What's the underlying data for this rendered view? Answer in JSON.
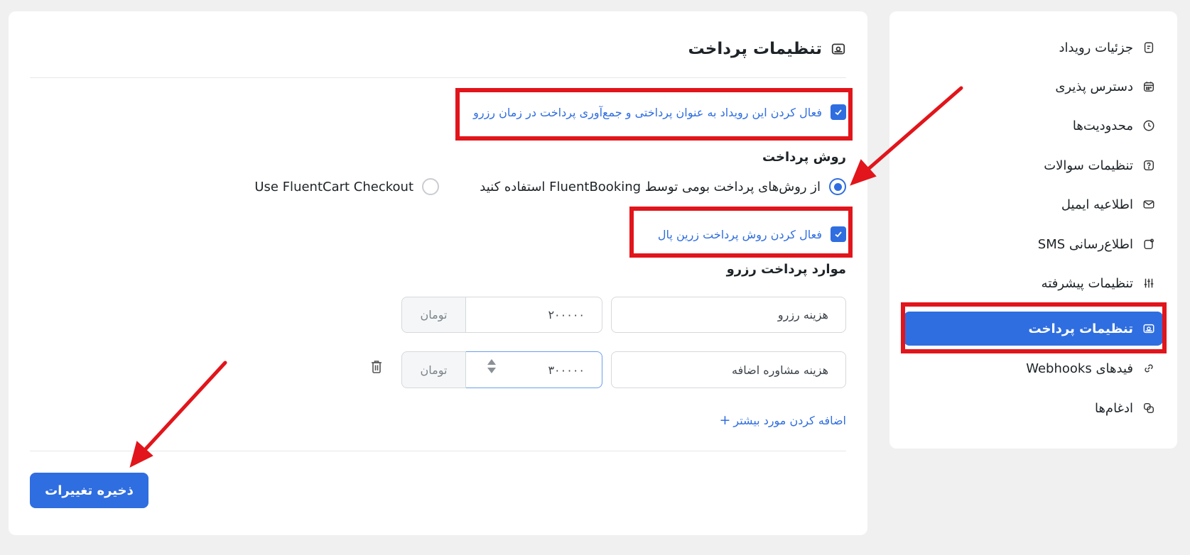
{
  "sidebar": {
    "items": [
      {
        "label": "جزئیات رویداد",
        "icon": "document-icon"
      },
      {
        "label": "دسترس پذیری",
        "icon": "calendar-icon"
      },
      {
        "label": "محدودیت‌ها",
        "icon": "clock-icon"
      },
      {
        "label": "تنظیمات سوالات",
        "icon": "question-icon"
      },
      {
        "label": "اطلاعیه ایمیل",
        "icon": "mail-icon"
      },
      {
        "label": "اطلاع‌رسانی SMS",
        "icon": "sms-icon"
      },
      {
        "label": "تنظیمات پیشرفته",
        "icon": "sliders-icon"
      },
      {
        "label": "تنظیمات پرداخت",
        "icon": "payment-icon",
        "active": true
      },
      {
        "label": "فیدهای Webhooks",
        "icon": "link-icon"
      },
      {
        "label": "ادغام‌ها",
        "icon": "integration-icon"
      }
    ]
  },
  "main": {
    "title": "تنظیمات پرداخت",
    "enable_payment_label": "فعال کردن این رویداد به عنوان پرداختی و جمع‌آوری پرداخت در زمان رزرو",
    "payment_method_title": "روش پرداخت",
    "method_native_label": "از روش‌های پرداخت بومی توسط FluentBooking استفاده کنید",
    "method_fluentcart_label": "Use FluentCart Checkout",
    "enable_zarinpal_label": "فعال کردن روش پرداخت زرین پال",
    "items_title": "موارد پرداخت رزرو",
    "items": [
      {
        "name": "هزینه رزرو",
        "amount": "۲۰۰۰۰۰",
        "currency": "تومان"
      },
      {
        "name": "هزینه مشاوره اضافه",
        "amount": "۳۰۰۰۰۰",
        "currency": "تومان"
      }
    ],
    "add_more_label": "اضافه کردن مورد بیشتر",
    "save_label": "ذخیره تغییرات"
  },
  "colors": {
    "accent": "#2f6ee0",
    "annotation": "#e1151b"
  }
}
